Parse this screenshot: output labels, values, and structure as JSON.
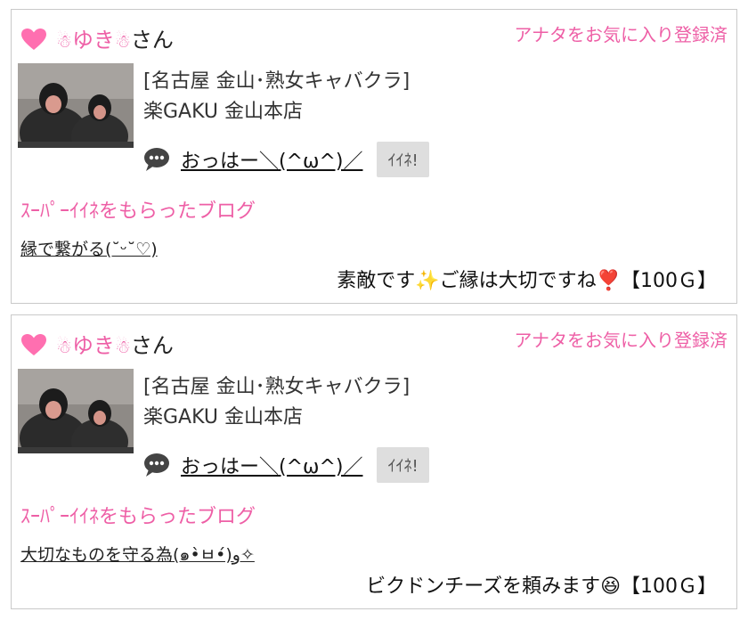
{
  "cards": [
    {
      "user_name": "ゆき",
      "snowman_emoji": "☃",
      "honorific": "さん",
      "favorite_status": "アナタをお気に入り登録済",
      "shop_line1": "[名古屋 金山･熟女キャバクラ]",
      "shop_line2": "楽GAKU 金山本店",
      "message": "おっはー＼(^ω^)／",
      "iine_label": "ｲｲﾈ!",
      "super_label": "ｽｰﾊﾟｰｲｲﾈをもらったブログ",
      "blog_title": "縁で繋がる(˘ᵕ˘♡)",
      "comment": "素敵です✨ご縁は大切ですね❣️【100Ｇ】"
    },
    {
      "user_name": "ゆき",
      "snowman_emoji": "☃",
      "honorific": "さん",
      "favorite_status": "アナタをお気に入り登録済",
      "shop_line1": "[名古屋 金山･熟女キャバクラ]",
      "shop_line2": "楽GAKU 金山本店",
      "message": "おっはー＼(^ω^)／",
      "iine_label": "ｲｲﾈ!",
      "super_label": "ｽｰﾊﾟｰｲｲﾈをもらったブログ",
      "blog_title": "大切なものを守る為(๑•̀ㅂ•́)و✧",
      "comment": "ビクドンチーズを頼みます😆【100Ｇ】"
    }
  ],
  "colors": {
    "accent_pink": "#ee5fa6",
    "border": "#c9c9c9",
    "button_gray": "#dedede"
  },
  "icons": [
    "heart-icon",
    "snowman-icon",
    "speech-bubble-icon"
  ]
}
